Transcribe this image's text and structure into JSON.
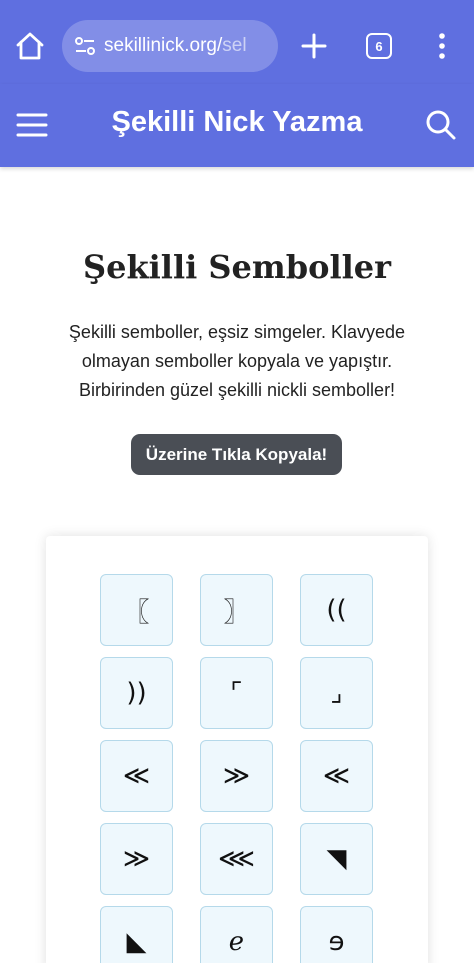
{
  "browser": {
    "url_main": "sekillinick.org/",
    "url_rest": "sel",
    "tab_count": "6"
  },
  "header": {
    "title": "Şekilli Nick Yazma"
  },
  "main": {
    "title": "Şekilli Semboller",
    "description": "Şekilli semboller, eşsiz simgeler. Klavyede olmayan semboller kopyala ve yapıştır. Birbirinden güzel şekilli nickli semboller!",
    "copy_hint": "Üzerine Tıkla Kopyala!"
  },
  "symbols": [
    "〖",
    "〗",
    "((",
    "))",
    "⌜",
    "⌟",
    "≪",
    "≫",
    "≪",
    "≫",
    "⋘",
    "◥",
    "◣",
    "ℯ",
    "ɘ"
  ],
  "colors": {
    "brand": "#5f6fe0",
    "hint_bg": "#4a4e55",
    "tile_bg": "#eef8fd"
  }
}
